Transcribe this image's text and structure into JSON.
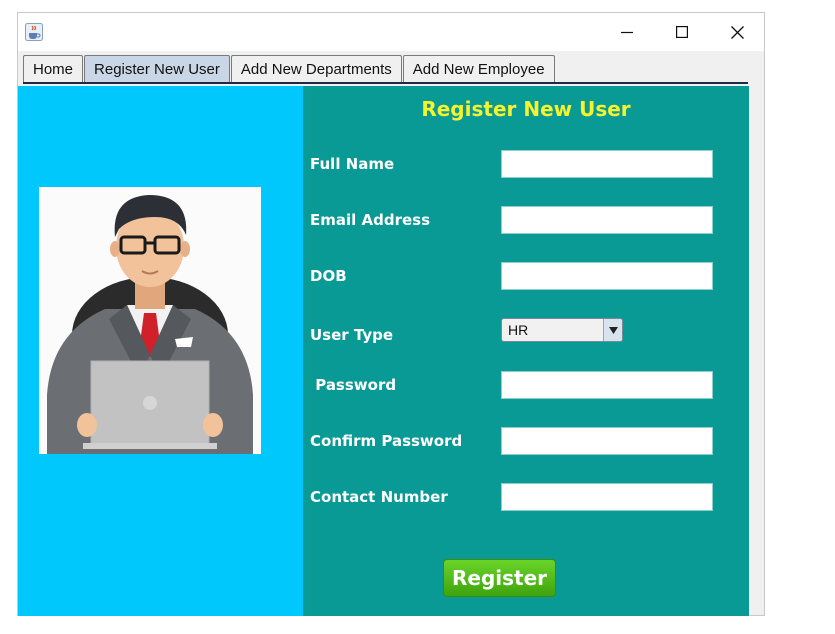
{
  "window": {
    "title": "",
    "controls": [
      "minimize",
      "maximize",
      "close"
    ]
  },
  "tabs": [
    {
      "label": "Home",
      "active": false
    },
    {
      "label": "Register New User",
      "active": true
    },
    {
      "label": "Add New Departments",
      "active": false
    },
    {
      "label": "Add New Employee",
      "active": false
    }
  ],
  "form": {
    "title": "Register New User",
    "fields": {
      "full_name": {
        "label": "Full Name",
        "value": ""
      },
      "email": {
        "label": "Email Address",
        "value": ""
      },
      "dob": {
        "label": "DOB",
        "value": ""
      },
      "user_type": {
        "label": "User Type",
        "selected": "HR"
      },
      "password": {
        "label": " Password",
        "value": ""
      },
      "confirm_password": {
        "label": "Confirm Password",
        "value": ""
      },
      "contact_number": {
        "label": "Contact Number",
        "value": ""
      }
    },
    "submit_label": "Register"
  },
  "colors": {
    "left_panel": "#00c8fc",
    "form_panel": "#0a9a96",
    "title_text": "#f5f22e",
    "register_button": "#4cb817",
    "active_tab": "#c8d6e6"
  },
  "icons": {
    "app": "java-cup-icon",
    "illustration": "businessman-with-laptop-illustration"
  }
}
